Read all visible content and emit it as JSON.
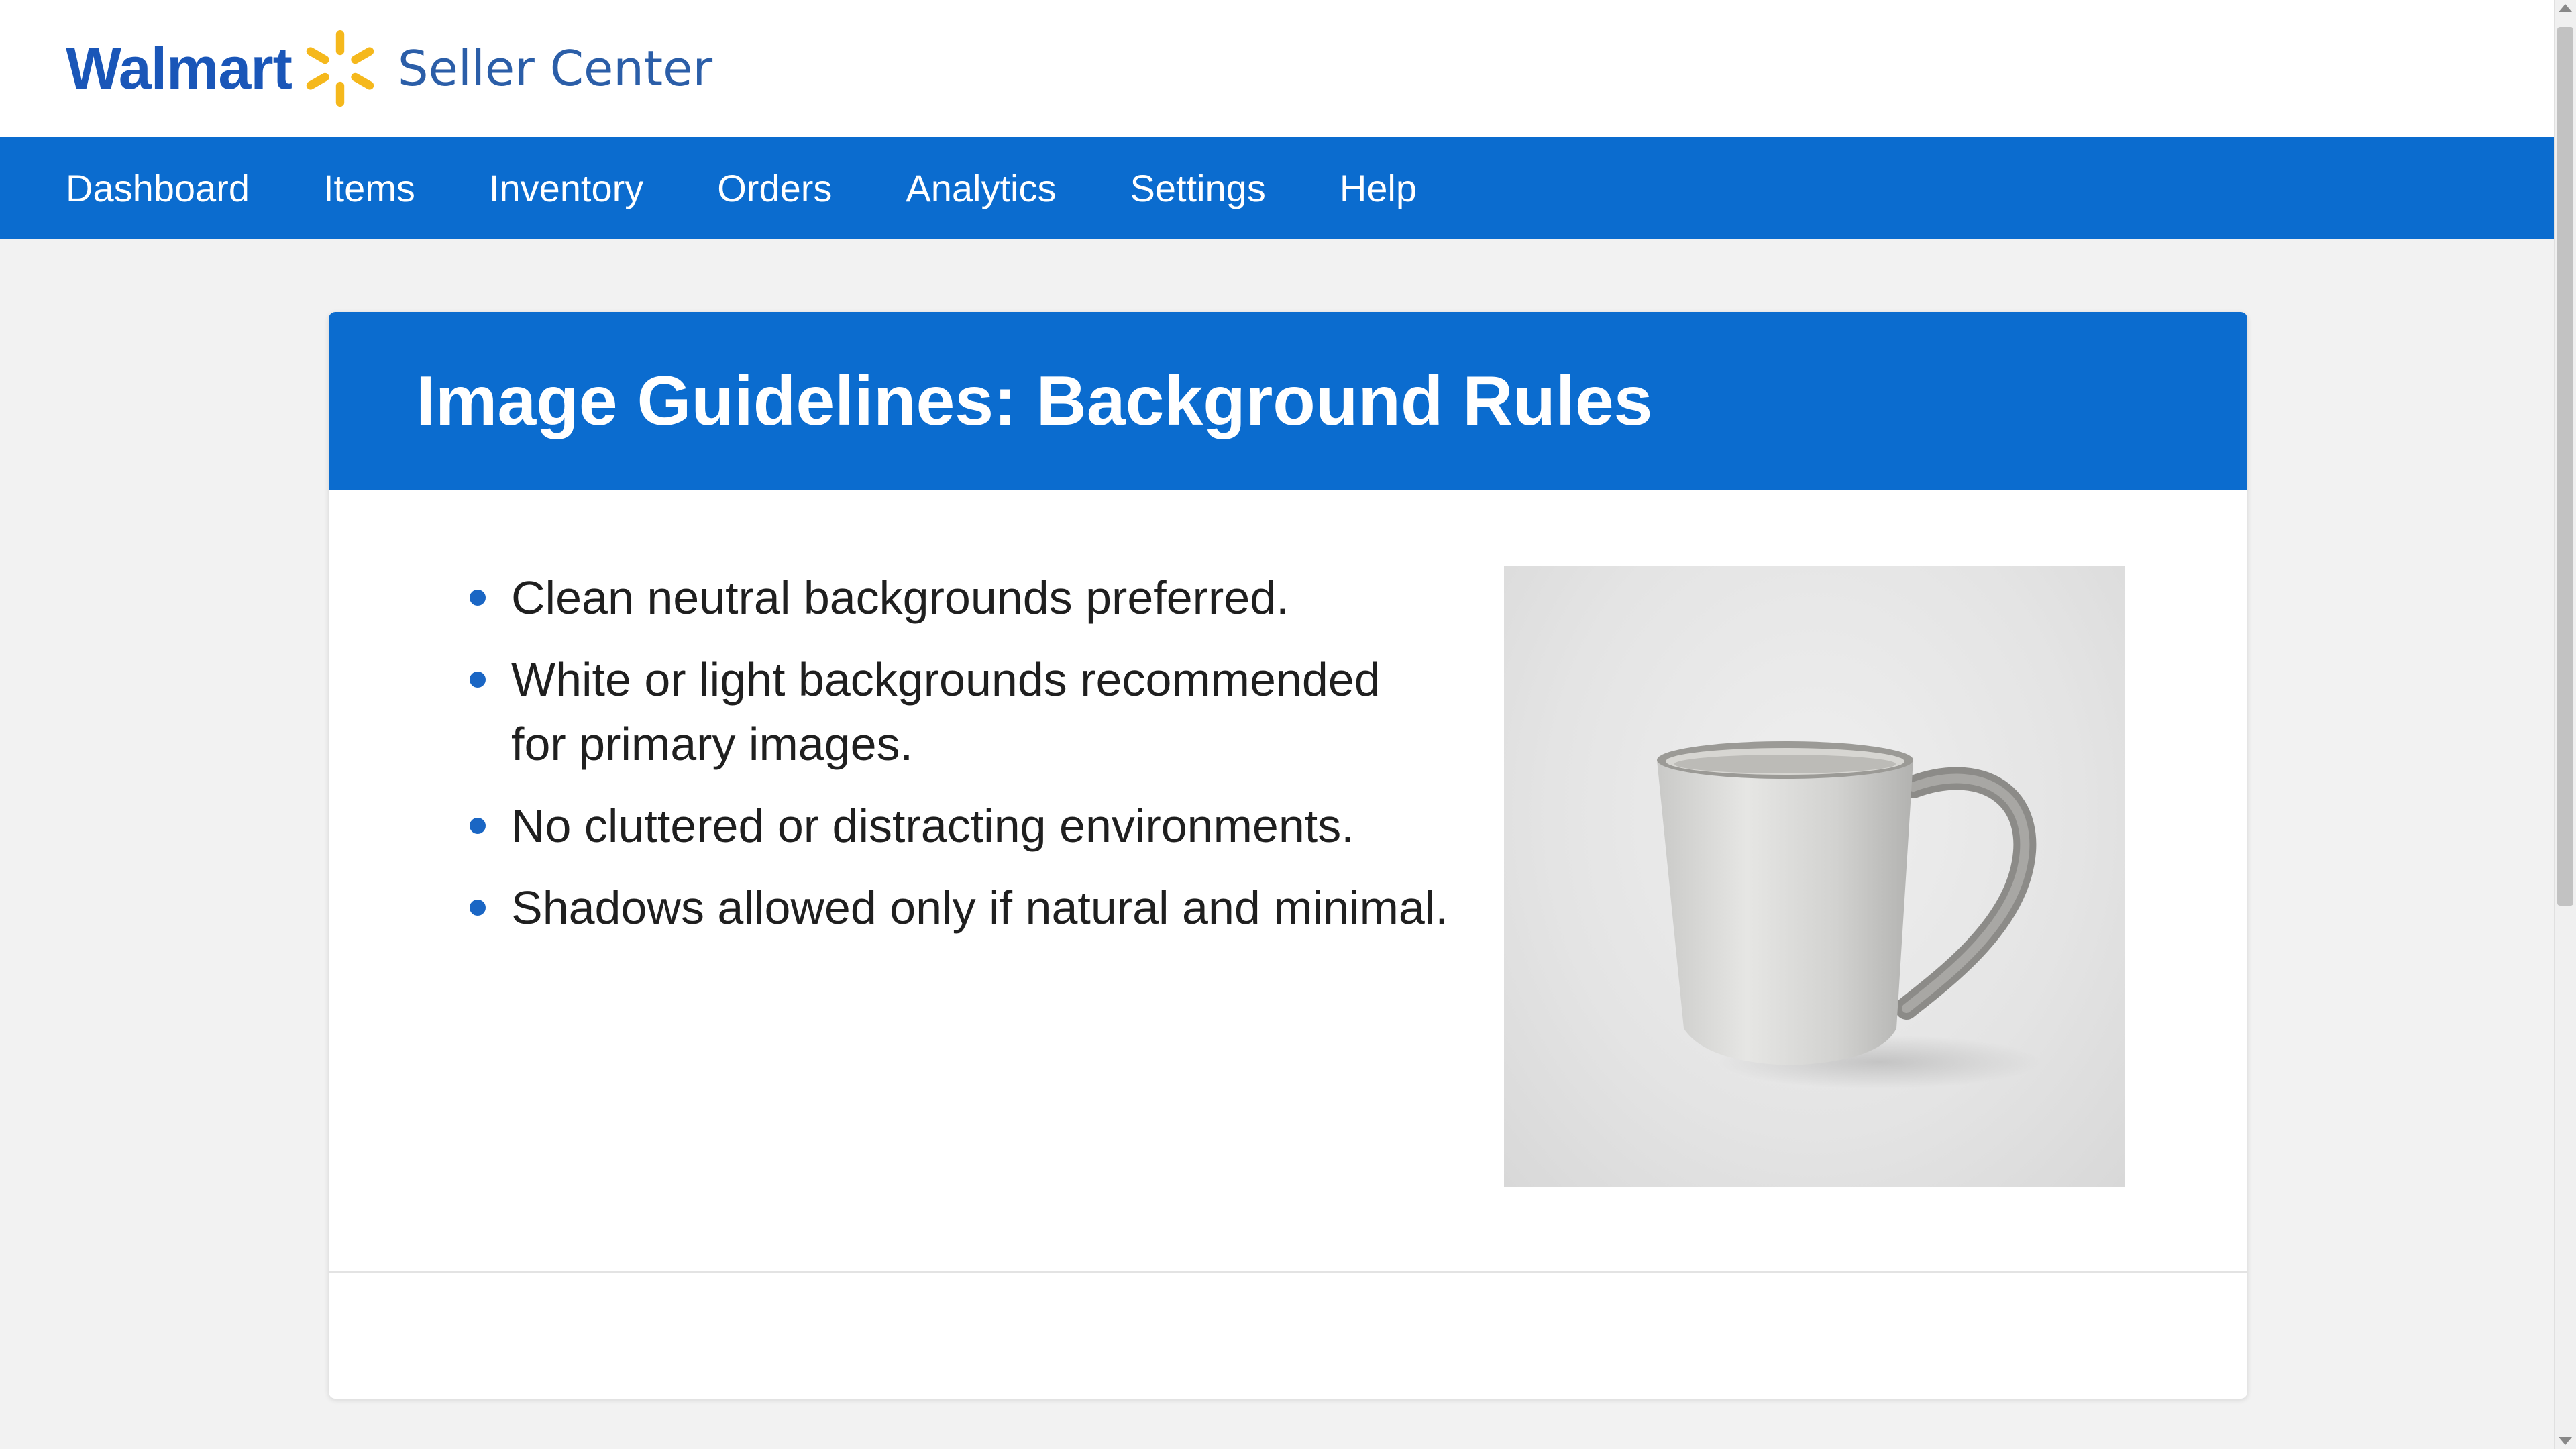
{
  "header": {
    "brand": "Walmart",
    "product": "Seller Center",
    "brand_color": "#1a56b8",
    "spark_color": "#f5b81c"
  },
  "nav": {
    "color": "#0b6ccf",
    "items": [
      {
        "label": "Dashboard"
      },
      {
        "label": "Items"
      },
      {
        "label": "Inventory"
      },
      {
        "label": "Orders"
      },
      {
        "label": "Analytics"
      },
      {
        "label": "Settings"
      },
      {
        "label": "Help"
      }
    ]
  },
  "card": {
    "title": "Image Guidelines: Background Rules",
    "bullets": [
      {
        "text": "Clean neutral backgrounds preferred."
      },
      {
        "line1": "White or light backgrounds recommended",
        "line2": "for primary images."
      },
      {
        "text": "No cluttered or distracting environments."
      },
      {
        "text": "Shadows allowed only if natural and minimal."
      }
    ],
    "image_icon": "mug-icon"
  }
}
